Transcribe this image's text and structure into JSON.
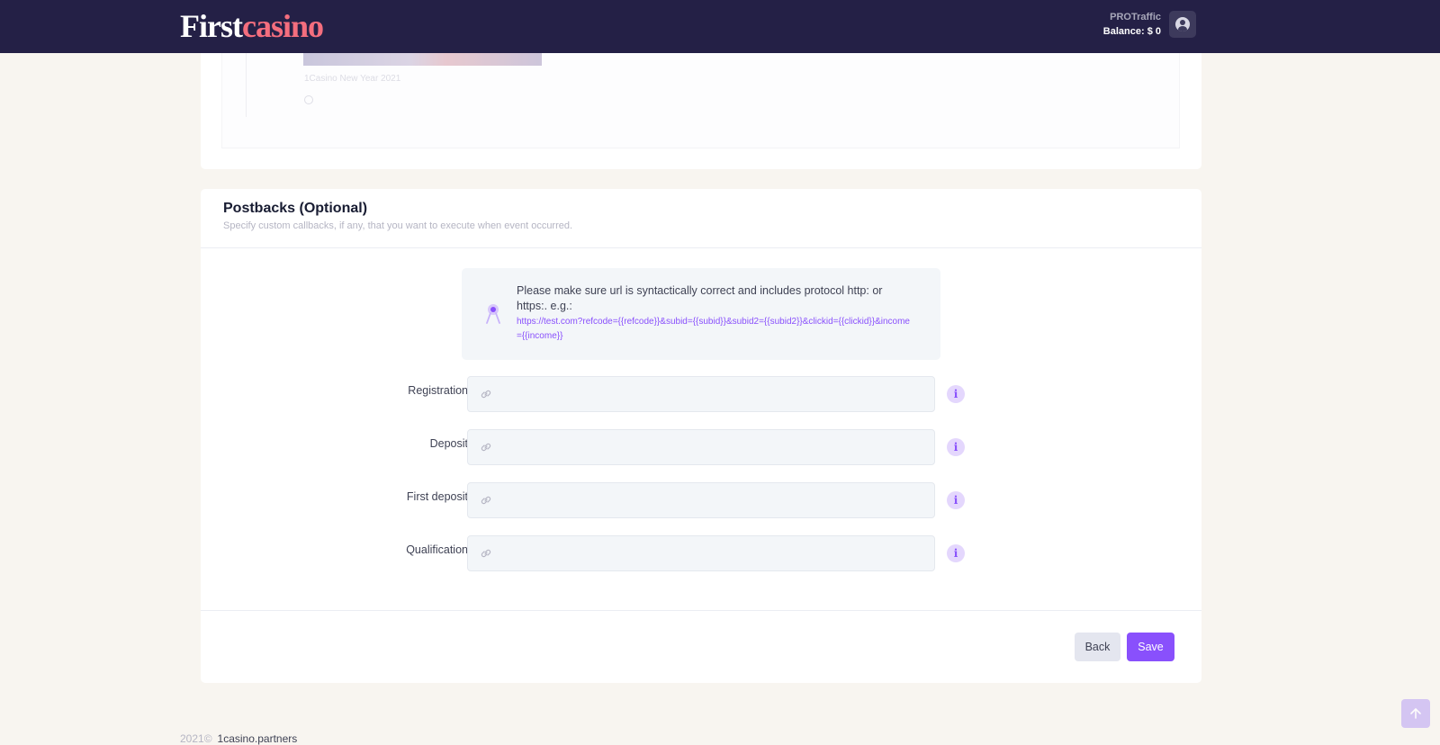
{
  "brand": {
    "logo_first": "First",
    "logo_casino": "casino"
  },
  "user": {
    "name": "PROTraffic",
    "balance": "Balance: $ 0"
  },
  "campaign": {
    "banner_caption": "1Casino New Year 2021"
  },
  "postbacks": {
    "title": "Postbacks (Optional)",
    "subtitle": "Specify custom callbacks, if any, that you want to execute when event occurred.",
    "notice_text": "Please make sure url is syntactically correct and includes protocol http: or https:. e.g.:",
    "notice_example": "https://test.com?refcode={{refcode}}&subid={{subid}}&subid2={{subid2}}&clickid={{clickid}}&income={{income}}",
    "fields": [
      {
        "label": "Registration",
        "value": "",
        "placeholder": ""
      },
      {
        "label": "Deposit",
        "value": "",
        "placeholder": ""
      },
      {
        "label": "First deposit",
        "value": "",
        "placeholder": ""
      },
      {
        "label": "Qualification",
        "value": "",
        "placeholder": ""
      }
    ],
    "info_glyph": "i",
    "back_label": "Back",
    "save_label": "Save"
  },
  "footer": {
    "year": "2021©",
    "site": "1casino.partners"
  },
  "colors": {
    "topbar": "#242046",
    "accent": "#8950fc",
    "logo_accent": "#f46e7e",
    "background": "#f8f5f0"
  },
  "icons": {
    "notice": "compass-icon",
    "field": "link-icon",
    "info": "info-icon",
    "scroll": "arrow-up-icon",
    "avatar": "user-icon"
  }
}
